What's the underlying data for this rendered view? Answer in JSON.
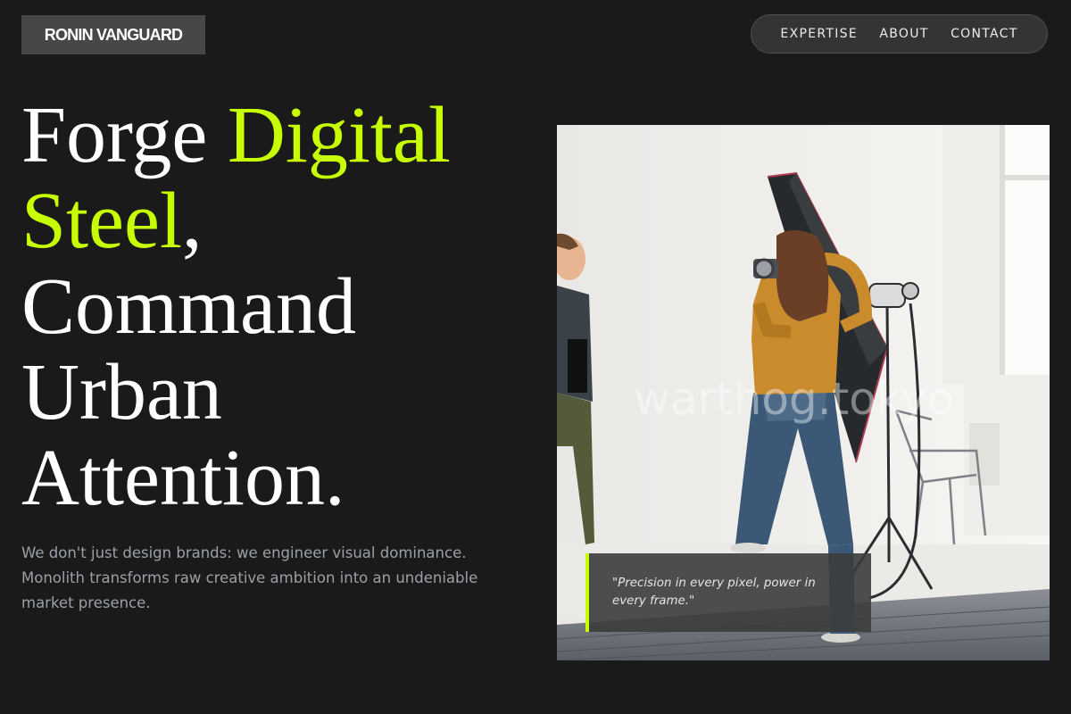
{
  "brand": {
    "name": "RONIN VANGUARD"
  },
  "nav": {
    "items": [
      "EXPERTISE",
      "ABOUT",
      "CONTACT"
    ]
  },
  "hero": {
    "headline": {
      "part1": "Forge ",
      "accent": "Digital Steel",
      "part2": ", Command Urban Attention."
    },
    "subtext": "We don't just design brands: we engineer visual dominance. Monolith transforms raw creative ambition into an undeniable market presence.",
    "image": {
      "watermark": "warthog.tokyo",
      "quote": "\"Precision in every pixel, power in every frame.\""
    }
  },
  "colors": {
    "background": "#1a1a1a",
    "accent": "#c8ff00",
    "muted_text": "#9aa0a8"
  }
}
